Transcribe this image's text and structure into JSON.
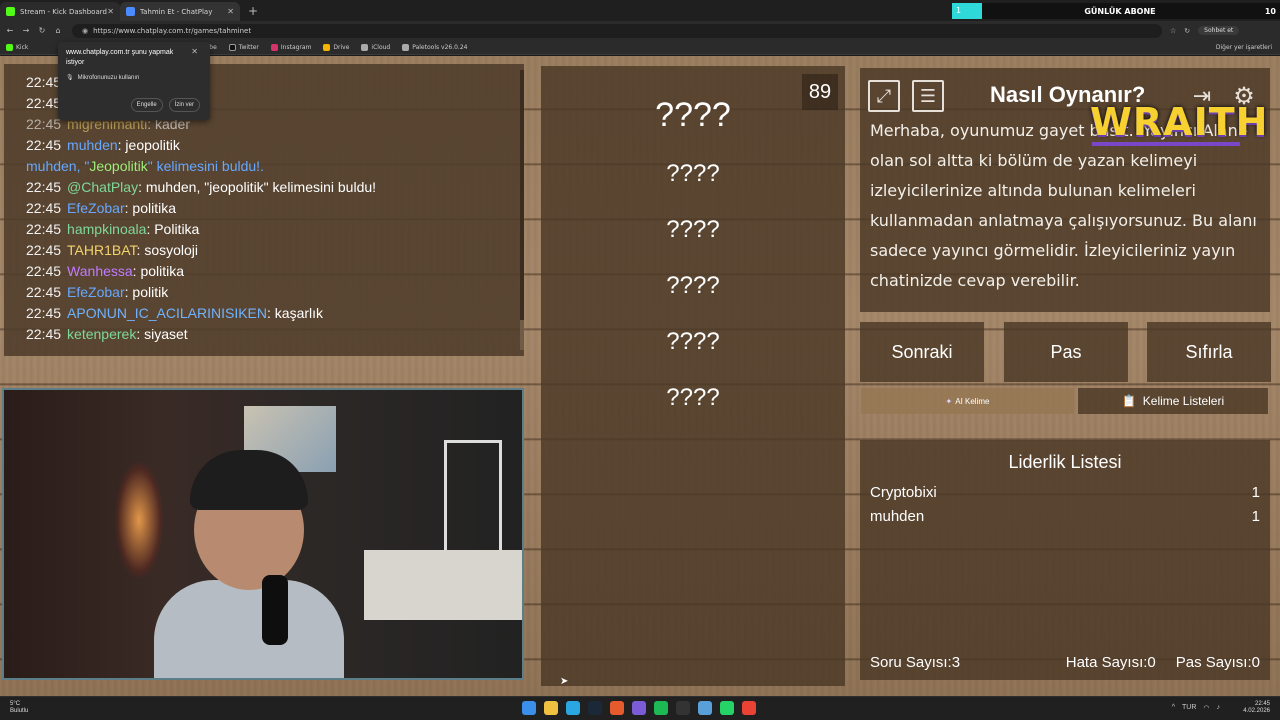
{
  "browser": {
    "tabs": [
      {
        "title": "Stream - Kick Dashboard",
        "color": "#53fc18"
      },
      {
        "title": "Tahmin Et - ChatPlay",
        "color": "#4a8cff"
      }
    ],
    "url": "https://www.chatplay.com.tr/games/tahminet",
    "chat_btn": "Sohbet et",
    "bookmarks": [
      "Kick",
      "YouTube",
      "Twitter",
      "Instagram",
      "Drive",
      "iCloud",
      "Paletools v26.0.24"
    ],
    "bookmarks_right": "Diğer yer işaretleri"
  },
  "overlay_abone": {
    "label": "GÜNLÜK ABONE",
    "count_left": "1",
    "count_right": "10"
  },
  "permission_popup": {
    "title": "www.chatplay.com.tr şunu yapmak istiyor",
    "item": "Mikrofonunuzu kullanın",
    "block": "Engelle",
    "allow": "İzin ver"
  },
  "chat": {
    "lines": [
      {
        "time": "22:45",
        "user": "",
        "user_class": "",
        "msg": ""
      },
      {
        "time": "22:45",
        "user": "",
        "user_class": "",
        "msg": ""
      },
      {
        "time": "22:45",
        "user": "migrenimanti",
        "user_class": "u-yellow",
        "msg": ": kader"
      },
      {
        "time": "22:45",
        "user": "muhden",
        "user_class": "u-blue",
        "msg": ": jeopolitik"
      },
      {
        "time": "",
        "user": "",
        "user_class": "",
        "msg": ""
      },
      {
        "time": "22:45",
        "user": "@ChatPlay",
        "user_class": "u-green",
        "msg": ": muhden, \"jeopolitik\" kelimesini buldu!"
      },
      {
        "time": "22:45",
        "user": "EfeZobar",
        "user_class": "u-blue",
        "msg": ": politika"
      },
      {
        "time": "22:45",
        "user": "hampkinoala",
        "user_class": "u-green",
        "msg": ": Politika"
      },
      {
        "time": "22:45",
        "user": "TAHR1BAT",
        "user_class": "u-yellow",
        "msg": ": sosyoloji"
      },
      {
        "time": "22:45",
        "user": "Wanhessa",
        "user_class": "u-purple",
        "msg": ": politika"
      },
      {
        "time": "22:45",
        "user": "EfeZobar",
        "user_class": "u-blue",
        "msg": ": politik"
      },
      {
        "time": "22:45",
        "user": "APONUN_IC_ACILARINISIKEN",
        "user_class": "u-cyan",
        "msg": ": kaşarlık"
      },
      {
        "time": "22:45",
        "user": "ketenperek",
        "user_class": "u-green",
        "msg": ": siyaset"
      }
    ],
    "system_line": {
      "pre": "muhden, \"",
      "highlight": "Jeopolitik",
      "post": "\" kelimesini buldu!."
    }
  },
  "game": {
    "counter": "89",
    "main_word": "????",
    "words": [
      "????",
      "????",
      "????",
      "????",
      "????"
    ],
    "rules_title": "Nasıl Oynanır?",
    "rules_text": "Merhaba, oyunumuz gayet basit. -Yayıncı Alanı- olan sol altta ki bölüm de yazan kelimeyi izleyicilerinize altında bulunan kelimeleri kullanmadan anlatmaya çalışıyorsunuz. Bu alanı sadece yayıncı görmelidir. İzleyicileriniz yayın chatinizde cevap verebilir.",
    "buttons": {
      "next": "Sonraki",
      "pass": "Pas",
      "reset": "Sıfırla"
    },
    "ai_word": "AI Kelime",
    "word_lists": "Kelime Listeleri",
    "leaderboard": {
      "title": "Liderlik Listesi",
      "rows": [
        {
          "name": "Cryptobixi",
          "score": "1"
        },
        {
          "name": "muhden",
          "score": "1"
        }
      ]
    },
    "stats": {
      "questions": "Soru Sayısı:3",
      "errors": "Hata Sayısı:0",
      "passes": "Pas Sayısı:0"
    }
  },
  "overlay_logo": "WRAITH",
  "taskbar": {
    "weather_temp": "5°C",
    "weather_desc": "Bulutlu",
    "time": "22:45",
    "date": "4.02.2026",
    "lang": "TUR"
  }
}
